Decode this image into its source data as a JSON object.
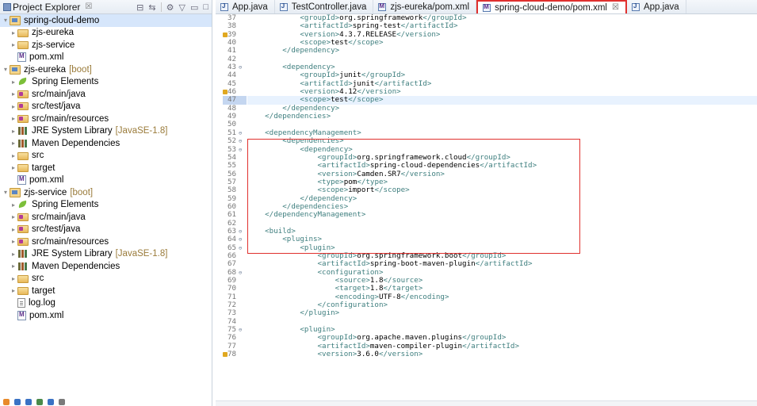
{
  "explorer": {
    "title": "Project Explorer",
    "close_glyph": "☒",
    "tree": [
      {
        "label": "spring-cloud-demo",
        "icon": "project-icon",
        "indent": 0,
        "arrow": "▾",
        "selected": true,
        "deco": ""
      },
      {
        "label": "zjs-eureka",
        "icon": "folder-icon",
        "indent": 1,
        "arrow": "▸",
        "deco": ""
      },
      {
        "label": "zjs-service",
        "icon": "folder-icon",
        "indent": 1,
        "arrow": "▸",
        "deco": ""
      },
      {
        "label": "pom.xml",
        "icon": "pom-file-icon",
        "indent": 1,
        "arrow": "",
        "deco": ""
      },
      {
        "label": "zjs-eureka",
        "icon": "project-icon",
        "indent": 0,
        "arrow": "▾",
        "deco": "[boot]"
      },
      {
        "label": "Spring Elements",
        "icon": "spring-leaf-icon",
        "indent": 1,
        "arrow": "▸",
        "deco": ""
      },
      {
        "label": "src/main/java",
        "icon": "source-folder-icon",
        "indent": 1,
        "arrow": "▸",
        "deco": ""
      },
      {
        "label": "src/test/java",
        "icon": "source-folder-icon",
        "indent": 1,
        "arrow": "▸",
        "deco": ""
      },
      {
        "label": "src/main/resources",
        "icon": "source-folder-icon",
        "indent": 1,
        "arrow": "▸",
        "deco": ""
      },
      {
        "label": "JRE System Library",
        "icon": "library-icon",
        "indent": 1,
        "arrow": "▸",
        "deco": "[JavaSE-1.8]"
      },
      {
        "label": "Maven Dependencies",
        "icon": "library-icon",
        "indent": 1,
        "arrow": "▸",
        "deco": ""
      },
      {
        "label": "src",
        "icon": "folder-icon",
        "indent": 1,
        "arrow": "▸",
        "deco": ""
      },
      {
        "label": "target",
        "icon": "folder-icon",
        "indent": 1,
        "arrow": "▸",
        "deco": ""
      },
      {
        "label": "pom.xml",
        "icon": "pom-file-icon",
        "indent": 1,
        "arrow": "",
        "deco": ""
      },
      {
        "label": "zjs-service",
        "icon": "project-icon",
        "indent": 0,
        "arrow": "▾",
        "deco": "[boot]"
      },
      {
        "label": "Spring Elements",
        "icon": "spring-leaf-icon",
        "indent": 1,
        "arrow": "▸",
        "deco": ""
      },
      {
        "label": "src/main/java",
        "icon": "source-folder-icon",
        "indent": 1,
        "arrow": "▸",
        "deco": ""
      },
      {
        "label": "src/test/java",
        "icon": "source-folder-icon",
        "indent": 1,
        "arrow": "▸",
        "deco": ""
      },
      {
        "label": "src/main/resources",
        "icon": "source-folder-icon",
        "indent": 1,
        "arrow": "▸",
        "deco": ""
      },
      {
        "label": "JRE System Library",
        "icon": "library-icon",
        "indent": 1,
        "arrow": "▸",
        "deco": "[JavaSE-1.8]"
      },
      {
        "label": "Maven Dependencies",
        "icon": "library-icon",
        "indent": 1,
        "arrow": "▸",
        "deco": ""
      },
      {
        "label": "src",
        "icon": "folder-icon",
        "indent": 1,
        "arrow": "▸",
        "deco": ""
      },
      {
        "label": "target",
        "icon": "folder-icon",
        "indent": 1,
        "arrow": "▸",
        "deco": ""
      },
      {
        "label": "log.log",
        "icon": "text-file-icon",
        "indent": 1,
        "arrow": "",
        "deco": ""
      },
      {
        "label": "pom.xml",
        "icon": "pom-file-icon",
        "indent": 1,
        "arrow": "",
        "deco": ""
      }
    ]
  },
  "tabs": [
    {
      "label": "App.java",
      "icon": "java-file-icon",
      "active": false
    },
    {
      "label": "TestController.java",
      "icon": "java-file-icon",
      "active": false
    },
    {
      "label": "zjs-eureka/pom.xml",
      "icon": "pom-file-icon",
      "active": false
    },
    {
      "label": "spring-cloud-demo/pom.xml",
      "icon": "pom-file-icon",
      "active": true
    },
    {
      "label": "App.java",
      "icon": "java-file-icon",
      "active": false
    }
  ],
  "active_tab_close": "☒",
  "editor": {
    "lines": [
      {
        "n": "37",
        "indent": 3,
        "tag": "groupId",
        "text": "org.springframework"
      },
      {
        "n": "38",
        "indent": 3,
        "tag": "artifactId",
        "text": "spring-test"
      },
      {
        "n": "39",
        "indent": 3,
        "tag": "version",
        "text": "4.3.7.RELEASE",
        "warn": true
      },
      {
        "n": "40",
        "indent": 3,
        "tag": "scope",
        "text": "test"
      },
      {
        "n": "41",
        "indent": 2,
        "close": "dependency"
      },
      {
        "n": "42",
        "indent": 0,
        "blank": true
      },
      {
        "n": "43",
        "indent": 2,
        "open": "dependency",
        "fold": true
      },
      {
        "n": "44",
        "indent": 3,
        "tag": "groupId",
        "text": "junit"
      },
      {
        "n": "45",
        "indent": 3,
        "tag": "artifactId",
        "text": "junit"
      },
      {
        "n": "46",
        "indent": 3,
        "tag": "version",
        "text": "4.12",
        "warn": true
      },
      {
        "n": "47",
        "indent": 3,
        "tag": "scope",
        "text": "test",
        "current": true
      },
      {
        "n": "48",
        "indent": 2,
        "close": "dependency"
      },
      {
        "n": "49",
        "indent": 1,
        "close": "dependencies"
      },
      {
        "n": "50",
        "indent": 0,
        "blank": true
      },
      {
        "n": "51",
        "indent": 1,
        "open": "dependencyManagement",
        "fold": true
      },
      {
        "n": "52",
        "indent": 2,
        "open": "dependencies",
        "fold": true
      },
      {
        "n": "53",
        "indent": 3,
        "open": "dependency",
        "fold": true
      },
      {
        "n": "54",
        "indent": 4,
        "tag": "groupId",
        "text": "org.springframework.cloud"
      },
      {
        "n": "55",
        "indent": 4,
        "tag": "artifactId",
        "text": "spring-cloud-dependencies"
      },
      {
        "n": "56",
        "indent": 4,
        "tag": "version",
        "text": "Camden.SR7"
      },
      {
        "n": "57",
        "indent": 4,
        "tag": "type",
        "text": "pom"
      },
      {
        "n": "58",
        "indent": 4,
        "tag": "scope",
        "text": "import"
      },
      {
        "n": "59",
        "indent": 3,
        "close": "dependency"
      },
      {
        "n": "60",
        "indent": 2,
        "close": "dependencies"
      },
      {
        "n": "61",
        "indent": 1,
        "close": "dependencyManagement"
      },
      {
        "n": "62",
        "indent": 0,
        "blank": true
      },
      {
        "n": "63",
        "indent": 1,
        "open": "build",
        "fold": true
      },
      {
        "n": "64",
        "indent": 2,
        "open": "plugins",
        "fold": true
      },
      {
        "n": "65",
        "indent": 3,
        "open": "plugin",
        "fold": true
      },
      {
        "n": "66",
        "indent": 4,
        "tag": "groupId",
        "text": "org.springframework.boot"
      },
      {
        "n": "67",
        "indent": 4,
        "tag": "artifactId",
        "text": "spring-boot-maven-plugin"
      },
      {
        "n": "68",
        "indent": 4,
        "open": "configuration",
        "fold": true
      },
      {
        "n": "69",
        "indent": 5,
        "tag": "source",
        "text": "1.8"
      },
      {
        "n": "70",
        "indent": 5,
        "tag": "target",
        "text": "1.8"
      },
      {
        "n": "71",
        "indent": 5,
        "tag": "encoding",
        "text": "UTF-8"
      },
      {
        "n": "72",
        "indent": 4,
        "close": "configuration"
      },
      {
        "n": "73",
        "indent": 3,
        "close": "plugin"
      },
      {
        "n": "74",
        "indent": 0,
        "blank": true
      },
      {
        "n": "75",
        "indent": 3,
        "open": "plugin",
        "fold": true
      },
      {
        "n": "76",
        "indent": 4,
        "tag": "groupId",
        "text": "org.apache.maven.plugins"
      },
      {
        "n": "77",
        "indent": 4,
        "tag": "artifactId",
        "text": "maven-compiler-plugin"
      },
      {
        "n": "78",
        "indent": 4,
        "tag": "version",
        "text": "3.6.0",
        "warn": true
      }
    ]
  },
  "colors": {
    "tag": "#3f7f7f",
    "annotation_box": "#e0302e",
    "selection": "#d6e6fb"
  }
}
